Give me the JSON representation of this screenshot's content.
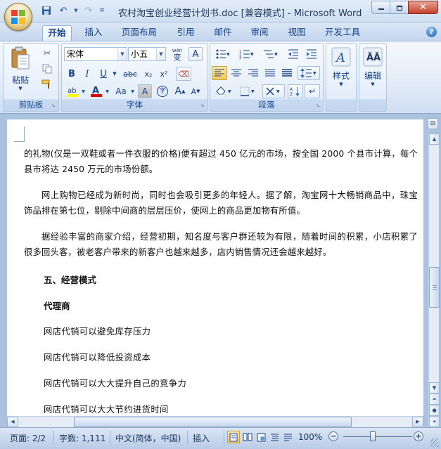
{
  "window": {
    "title": "农村淘宝创业经营计划书.doc [兼容模式] - Microsoft Word"
  },
  "tabs": [
    {
      "label": "开始",
      "active": true
    },
    {
      "label": "插入"
    },
    {
      "label": "页面布局"
    },
    {
      "label": "引用"
    },
    {
      "label": "邮件"
    },
    {
      "label": "审阅"
    },
    {
      "label": "视图"
    },
    {
      "label": "开发工具"
    }
  ],
  "ribbon": {
    "clipboard": {
      "label": "剪贴板",
      "paste": "粘贴"
    },
    "font": {
      "label": "字体",
      "font_name": "宋体",
      "font_size": "小五",
      "bold": "B",
      "italic": "I",
      "underline": "U",
      "strike": "abc",
      "subscript": "x₂",
      "superscript": "x²",
      "grow": "A",
      "shrink": "A",
      "case": "Aa",
      "phonetic": "wén",
      "phonetic_char": "变",
      "border_char": "A",
      "enclose_char": "字"
    },
    "paragraph": {
      "label": "段落"
    },
    "styles": {
      "label": "样式"
    },
    "editing": {
      "label": "编辑"
    }
  },
  "document": {
    "paragraphs": [
      "的礼物(仅是一双鞋或者一件衣服的价格)便有超过 450 亿元的市场，按全国 2000 个县市计算，每个县市将达 2450 万元的市场份额。",
      "网上购物已经成为新时尚，同时也会吸引更多的年轻人。据了解，淘宝网十大畅销商品中，珠宝饰品排在第七位，剔除中间商的层层压价，使网上的商品更加物有所值。",
      "据经验丰富的商家介绍，经营初期，知名度与客户群还较为有限，随着时间的积累，小店积累了很多回头客，被老客户带来的新客户也越来越多，店内销售情况还会越来越好。"
    ],
    "heading1": "五、经营模式",
    "heading2": "代理商",
    "lines": [
      "网店代销可以避免库存压力",
      "网店代销可以降低投资成本",
      "网店代销可以大大提升自己的竞争力",
      "网店代销可以大大节约进货时间"
    ]
  },
  "status": {
    "page": "页面: 2/2",
    "words": "字数: 1,111",
    "language": "中文(简体，中国)",
    "mode": "插入",
    "zoom": "100%",
    "zoom_minus": "−",
    "zoom_plus": "+"
  },
  "colors": {
    "highlight": "#ffff00",
    "font_color": "#e00000",
    "ribbon_bg": "#dbe7f5",
    "accent": "#15428b"
  }
}
